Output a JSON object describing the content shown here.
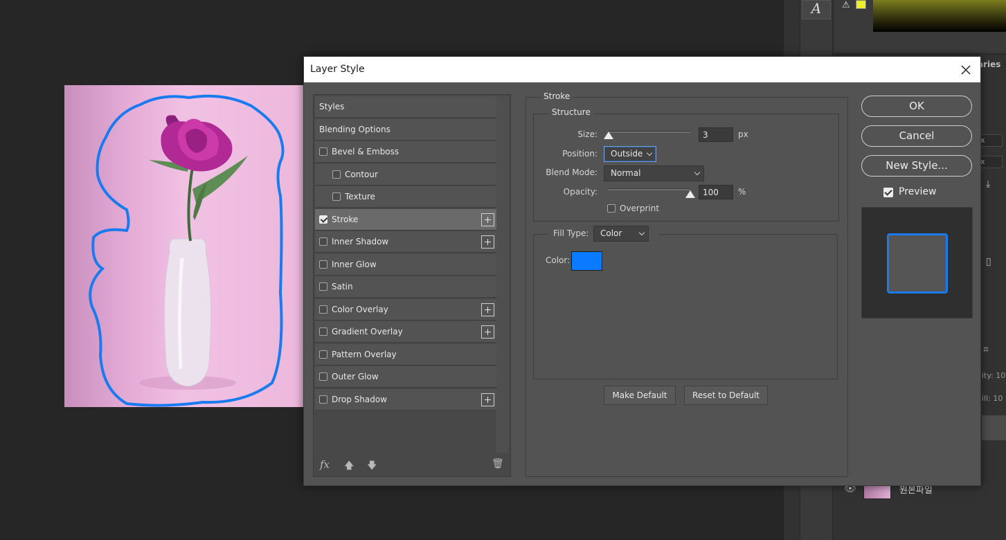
{
  "dialog": {
    "title": "Layer Style",
    "close_icon": "close-icon"
  },
  "styles_list": {
    "header": "Styles",
    "blending_options": "Blending Options",
    "items": [
      {
        "label": "Bevel & Emboss",
        "checked": false,
        "plus": false,
        "indent": 0
      },
      {
        "label": "Contour",
        "checked": false,
        "plus": false,
        "indent": 1
      },
      {
        "label": "Texture",
        "checked": false,
        "plus": false,
        "indent": 1
      },
      {
        "label": "Stroke",
        "checked": true,
        "plus": true,
        "indent": 0,
        "selected": true
      },
      {
        "label": "Inner Shadow",
        "checked": false,
        "plus": true,
        "indent": 0
      },
      {
        "label": "Inner Glow",
        "checked": false,
        "plus": false,
        "indent": 0
      },
      {
        "label": "Satin",
        "checked": false,
        "plus": false,
        "indent": 0
      },
      {
        "label": "Color Overlay",
        "checked": false,
        "plus": true,
        "indent": 0
      },
      {
        "label": "Gradient Overlay",
        "checked": false,
        "plus": true,
        "indent": 0
      },
      {
        "label": "Pattern Overlay",
        "checked": false,
        "plus": false,
        "indent": 0
      },
      {
        "label": "Outer Glow",
        "checked": false,
        "plus": false,
        "indent": 0
      },
      {
        "label": "Drop Shadow",
        "checked": false,
        "plus": true,
        "indent": 0
      }
    ],
    "footer": {
      "fx": "fx",
      "up_icon": "arrow-up-icon",
      "down_icon": "arrow-down-icon",
      "trash_icon": "trash-icon"
    }
  },
  "stroke": {
    "group_title": "Stroke",
    "structure_title": "Structure",
    "size_label": "Size:",
    "size_value": "3",
    "size_unit": "px",
    "size_slider_fraction": 0.0,
    "position_label": "Position:",
    "position_value": "Outside",
    "blend_mode_label": "Blend Mode:",
    "blend_mode_value": "Normal",
    "opacity_label": "Opacity:",
    "opacity_value": "100",
    "opacity_unit": "%",
    "opacity_slider_fraction": 1.0,
    "overprint_label": "Overprint",
    "overprint_checked": false,
    "fill_type_label": "Fill Type:",
    "fill_type_value": "Color",
    "color_label": "Color:",
    "color_hex": "#0a7bff",
    "make_default": "Make Default",
    "reset_default": "Reset to Default"
  },
  "actions": {
    "ok": "OK",
    "cancel": "Cancel",
    "new_style": "New Style...",
    "preview_label": "Preview",
    "preview_checked": true
  },
  "workspace": {
    "type_tool_glyph": "A",
    "libraries_tab": "aries",
    "field_unit_1": "x",
    "field_unit_2": "x",
    "opacity_short": "ity:",
    "opacity_val": "10",
    "fill_short": "ill:",
    "fill_val": "10",
    "layer_name": "원본파일"
  },
  "colors": {
    "accent": "#0a7bff",
    "stroke_outline": "#1a7af0",
    "gamut_swatch": "#eded2f"
  }
}
